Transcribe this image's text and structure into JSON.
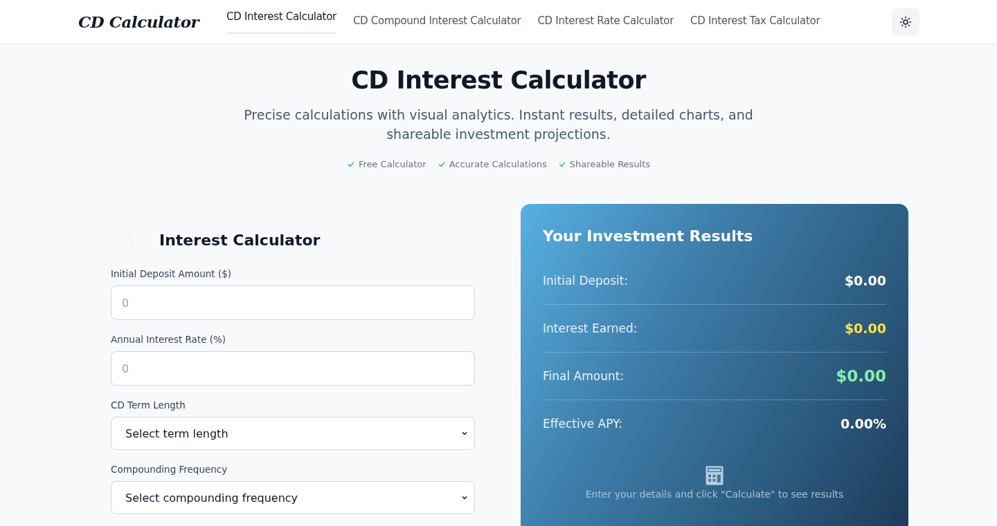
{
  "header": {
    "logo": "CD Calculator",
    "nav": [
      {
        "label": "CD Interest Calculator",
        "selected": true
      },
      {
        "label": "CD Compound Interest Calculator",
        "selected": false
      },
      {
        "label": "CD Interest Rate Calculator",
        "selected": false
      },
      {
        "label": "CD Interest Tax Calculator",
        "selected": false
      }
    ]
  },
  "hero": {
    "title": "CD Interest Calculator",
    "subtitle": "Precise calculations with visual analytics. Instant results, detailed charts, and shareable investment projections.",
    "features": [
      "Free Calculator",
      "Accurate Calculations",
      "Shareable Results"
    ]
  },
  "form": {
    "title": "Interest Calculator",
    "fields": [
      {
        "kind": "input",
        "label": "Initial Deposit Amount ($)",
        "placeholder": "0"
      },
      {
        "kind": "input",
        "label": "Annual Interest Rate (%)",
        "placeholder": "0"
      },
      {
        "kind": "select",
        "label": "CD Term Length",
        "value": "Select term length"
      },
      {
        "kind": "select",
        "label": "Compounding Frequency",
        "value": "Select compounding frequency"
      }
    ]
  },
  "results": {
    "title": "Your Investment Results",
    "rows": [
      {
        "label": "Initial Deposit:",
        "value": "$0.00",
        "color": "#ffffff"
      },
      {
        "label": "Interest Earned:",
        "value": "$0.00",
        "color": "#fde047"
      },
      {
        "label": "Final Amount:",
        "value": "$0.00",
        "color": "#86efac",
        "large": true
      },
      {
        "label": "Effective APY:",
        "value": "0.00%",
        "color": "#ffffff"
      }
    ],
    "hint": "Enter your details and click \"Calculate\" to see results"
  }
}
